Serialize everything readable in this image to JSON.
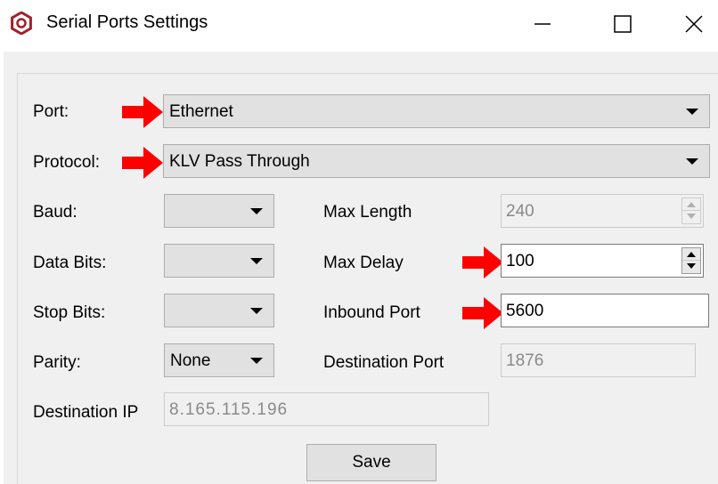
{
  "window": {
    "title": "Serial Ports Settings",
    "icon": "app-logo-icon",
    "controls": {
      "minimize": "minimize-icon",
      "maximize": "maximize-icon",
      "close": "close-icon"
    }
  },
  "form": {
    "port": {
      "label": "Port:",
      "value": "Ethernet"
    },
    "protocol": {
      "label": "Protocol:",
      "value": "KLV Pass Through"
    },
    "baud": {
      "label": "Baud:",
      "value": ""
    },
    "data_bits": {
      "label": "Data Bits:",
      "value": ""
    },
    "stop_bits": {
      "label": "Stop Bits:",
      "value": ""
    },
    "parity": {
      "label": "Parity:",
      "value": "None"
    },
    "destination_ip": {
      "label": "Destination IP",
      "value": "8.165.115.196"
    },
    "max_length": {
      "label": "Max Length",
      "value": "240"
    },
    "max_delay": {
      "label": "Max Delay",
      "value": "100"
    },
    "inbound_port": {
      "label": "Inbound Port",
      "value": "5600"
    },
    "destination_port": {
      "label": "Destination Port",
      "value": "1876"
    },
    "save_label": "Save"
  },
  "colors": {
    "annotation_arrow": "#ff0000",
    "logo": "#a0202a",
    "dialog_background": "#f0f0f0",
    "button_face": "#e1e1e1"
  }
}
